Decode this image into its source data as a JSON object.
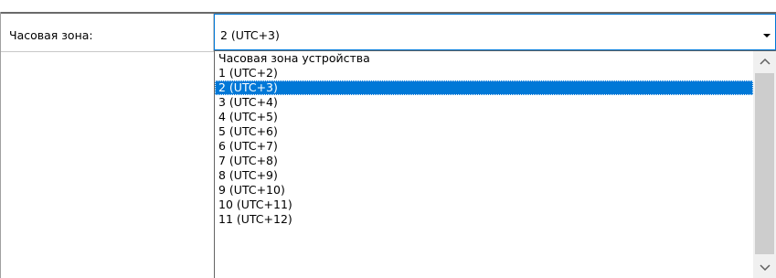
{
  "field": {
    "label": "Часовая зона:",
    "selected_value": "2 (UTC+3)"
  },
  "dropdown": {
    "options": [
      "Часовая зона устройства",
      "1 (UTC+2)",
      "2 (UTC+3)",
      "3 (UTC+4)",
      "4 (UTC+5)",
      "5 (UTC+6)",
      "6 (UTC+7)",
      "7 (UTC+8)",
      "8 (UTC+9)",
      "9 (UTC+10)",
      "10 (UTC+11)",
      "11 (UTC+12)"
    ],
    "selected_index": 2
  },
  "colors": {
    "selection": "#0078d7",
    "scrollbar_track": "#f0f0f0",
    "scrollbar_thumb": "#cdcdcd"
  },
  "icons": {
    "combo_arrow": "caret-down-icon",
    "scroll_up": "chevron-up-icon",
    "scroll_down": "chevron-down-icon"
  }
}
